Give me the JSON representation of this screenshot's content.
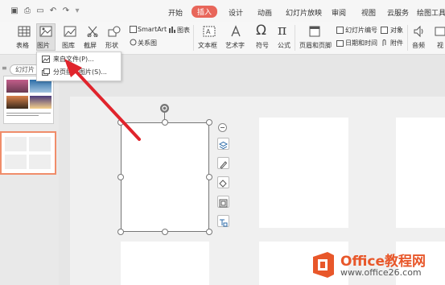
{
  "tabs": [
    "开始",
    "插入",
    "设计",
    "动画",
    "幻灯片放映",
    "审阅",
    "视图",
    "云服务",
    "绘图工具"
  ],
  "active_tab": "插入",
  "ribbon": {
    "table": "表格",
    "picture": "图片",
    "gallery": "图库",
    "screenshot": "截屏",
    "shape": "形状",
    "smartart": "SmartArt",
    "chart": "图表",
    "relation": "关系图",
    "textbox": "文本框",
    "wordart": "艺术字",
    "symbol": "符号",
    "formula": "公式",
    "header_footer": "页眉和页脚",
    "slide_number": "幻灯片编号",
    "object": "对象",
    "datetime": "日期和时间",
    "attachment": "附件",
    "audio": "音频",
    "video": "视"
  },
  "sidebar": {
    "tab_label": "幻灯片"
  },
  "dropdown": {
    "items": [
      "来自文件(P)...",
      "分页插入图片(S)..."
    ]
  },
  "logo": {
    "text": "Office教程网",
    "url": "www.office26.com",
    "brand_color": "#e8572a"
  },
  "colors": {
    "accent": "#e8665a",
    "arrow": "#e0242c"
  }
}
